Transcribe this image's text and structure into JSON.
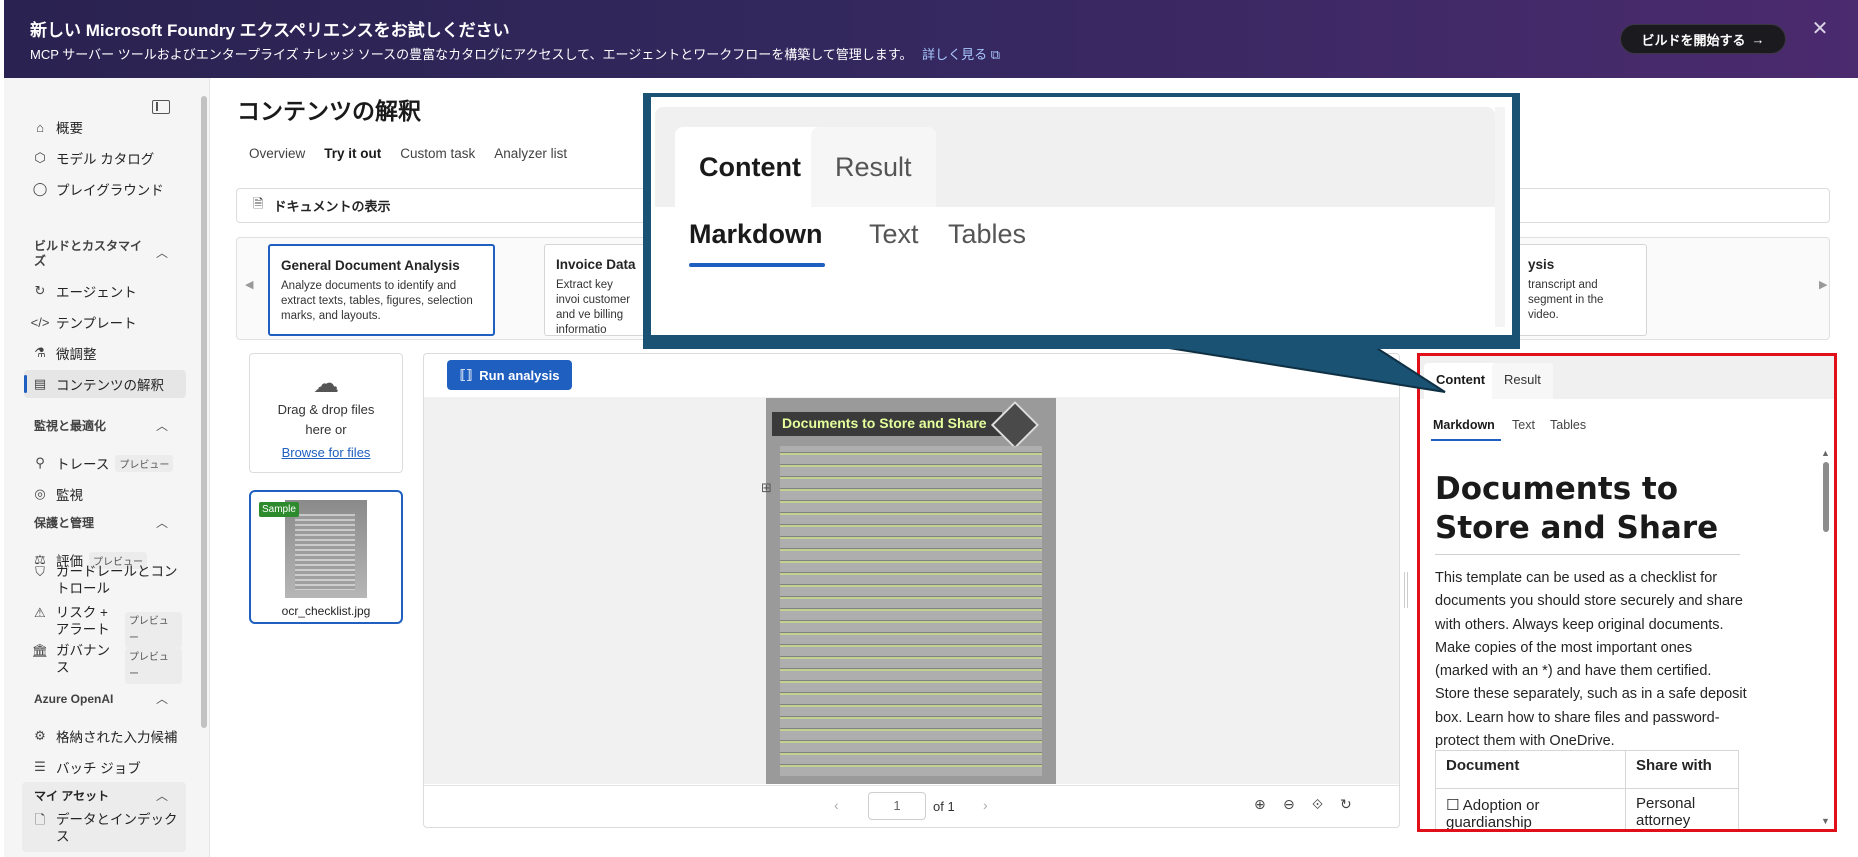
{
  "banner": {
    "title": "新しい Microsoft Foundry エクスペリエンスをお試しください",
    "description": "MCP サーバー ツールおよびエンタープライズ ナレッジ ソースの豊富なカタログにアクセスして、エージェントとワークフローを構築して管理します。",
    "link": "詳しく見る",
    "button": "ビルドを開始する",
    "close": "✕"
  },
  "sidebar": {
    "items": [
      {
        "label": "概要",
        "icon": "home-icon"
      },
      {
        "label": "モデル カタログ",
        "icon": "cube-icon"
      },
      {
        "label": "プレイグラウンド",
        "icon": "chat-icon"
      }
    ],
    "sections": [
      {
        "label": "ビルドとカスタマイズ"
      },
      {
        "label": "監視と最適化"
      },
      {
        "label": "保護と管理"
      },
      {
        "label": "Azure OpenAI"
      },
      {
        "label": "マイ アセット"
      }
    ],
    "build_items": [
      {
        "label": "エージェント"
      },
      {
        "label": "テンプレート"
      },
      {
        "label": "微調整"
      },
      {
        "label": "コンテンツの解釈"
      }
    ],
    "monitor_items": [
      {
        "label": "トレース",
        "tag": "プレビュー"
      },
      {
        "label": "監視"
      }
    ],
    "protect_items": [
      {
        "label": "評価",
        "tag": "プレビュー"
      },
      {
        "label": "ガードレールとコントロール"
      },
      {
        "label": "リスク + アラート",
        "tag": "プレビュー"
      },
      {
        "label": "ガバナンス",
        "tag": "プレビュー"
      }
    ],
    "openai_items": [
      {
        "label": "格納された入力候補"
      },
      {
        "label": "バッチ ジョブ"
      }
    ],
    "asset_items": [
      {
        "label": "データとインデックス"
      }
    ]
  },
  "main": {
    "title": "コンテンツの解釈",
    "tabs": [
      "Overview",
      "Try it out",
      "Custom task",
      "Analyzer list"
    ],
    "doc_bar": "ドキュメントの表示",
    "cards": [
      {
        "title": "General Document Analysis",
        "desc": "Analyze documents to identify and extract texts, tables, figures, selection marks, and layouts."
      },
      {
        "title": "Invoice Data E",
        "desc": "Extract key invoi customer and ve billing informatio"
      },
      {
        "title": "ysis",
        "desc": "transcript and segment in the video."
      }
    ],
    "upload": {
      "line1": "Drag & drop files",
      "line2": "here or",
      "link": "Browse for files"
    },
    "sample": {
      "badge": "Sample",
      "filename": "ocr_checklist.jpg"
    },
    "run_button": "Run analysis",
    "doc_heading": "Documents to Store and Share",
    "pager": {
      "page": "1",
      "of": "of 1"
    }
  },
  "result": {
    "tabs": [
      "Content",
      "Result"
    ],
    "subtabs": [
      "Markdown",
      "Text",
      "Tables"
    ],
    "heading": "Documents to Store and Share",
    "paragraph": "This template can be used as a checklist for documents you should store securely and share with others. Always keep original documents. Make copies of the most important ones (marked with an *) and have them certified. Store these separately, such as in a safe deposit box. Learn how to share files and password-protect them with OneDrive.",
    "table_headers": [
      "Document",
      "Share with"
    ],
    "table_rows": [
      [
        "☐ Adoption or guardianship",
        "Personal attorney"
      ]
    ]
  },
  "callout": {
    "tabs": [
      "Content",
      "Result"
    ],
    "subtabs": [
      "Markdown",
      "Text",
      "Tables"
    ],
    "color": "#1a5274"
  },
  "colors": {
    "accent": "#1f5fbf",
    "highlight": "#e0101a"
  }
}
